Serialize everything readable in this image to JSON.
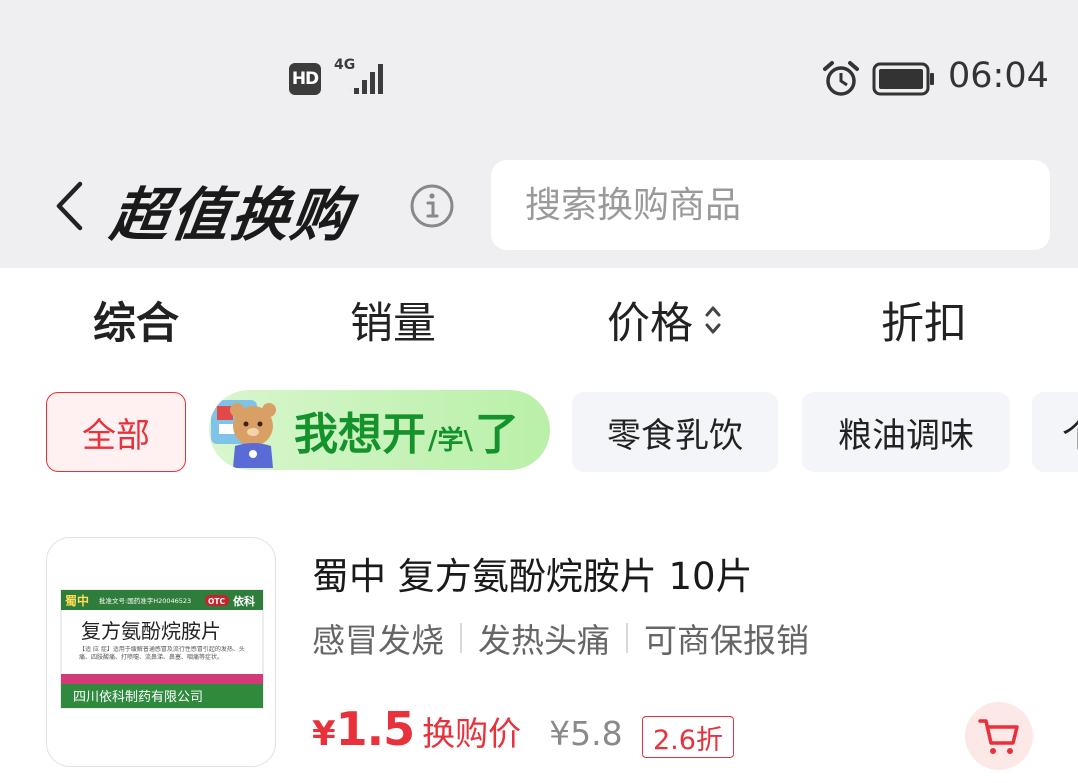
{
  "status_bar": {
    "hd": "HD",
    "network": "4G",
    "time": "06:04"
  },
  "header": {
    "title": "超值换购",
    "search_placeholder": "搜索换购商品"
  },
  "sort_tabs": [
    {
      "label": "综合",
      "active": true
    },
    {
      "label": "销量"
    },
    {
      "label": "价格"
    },
    {
      "label": "折扣"
    }
  ],
  "categories": {
    "all": "全部",
    "promo": {
      "main": "我想开",
      "small": "/学\\",
      "tail": "了"
    },
    "items": [
      "零食乳饮",
      "粮油调味",
      "个"
    ]
  },
  "product": {
    "title": "蜀中 复方氨酚烷胺片 10片",
    "tags": [
      "感冒发烧",
      "发热头痛",
      "可商保报销"
    ],
    "price_symbol": "¥",
    "price": "1.5",
    "price_label": "换购价",
    "original_price": "¥5.8",
    "discount": "2.6折",
    "image": {
      "brand": "蜀中",
      "approval": "批准文号:国药准字H20046523",
      "otc": "OTC",
      "brand2": "依科",
      "name": "复方氨酚烷胺片",
      "indication": "【适 应 症】适用于缓解普通感冒及流行性感冒引起的发热、头痛、四肢酸痛、打喷嚏、流鼻涕、鼻塞、咽痛等症状。",
      "maker": "四川依科制药有限公司"
    }
  },
  "colors": {
    "accent": "#e8313a",
    "promo_green": "#14922c",
    "background_top": "#efeff1"
  }
}
